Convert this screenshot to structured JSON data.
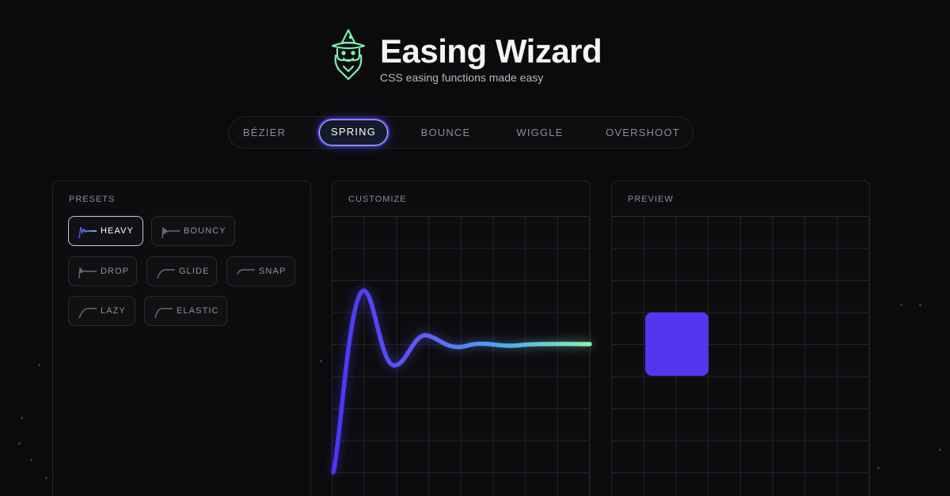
{
  "header": {
    "title": "Easing Wizard",
    "subtitle": "CSS easing functions made easy",
    "logo_icon": "wizard-icon"
  },
  "tabs": [
    {
      "label": "BÉZIER",
      "active": false
    },
    {
      "label": "SPRING",
      "active": true
    },
    {
      "label": "BOUNCE",
      "active": false
    },
    {
      "label": "WIGGLE",
      "active": false
    },
    {
      "label": "OVERSHOOT",
      "active": false
    }
  ],
  "panels": {
    "presets": {
      "label": "PRESETS",
      "items": [
        {
          "label": "HEAVY",
          "active": true
        },
        {
          "label": "BOUNCY",
          "active": false
        },
        {
          "label": "DROP",
          "active": false
        },
        {
          "label": "GLIDE",
          "active": false
        },
        {
          "label": "SNAP",
          "active": false
        },
        {
          "label": "LAZY",
          "active": false
        },
        {
          "label": "ELASTIC",
          "active": false
        }
      ]
    },
    "customize": {
      "label": "CUSTOMIZE"
    },
    "preview": {
      "label": "PREVIEW"
    }
  },
  "colors": {
    "background": "#0b0b0d",
    "accent": "#5536ee",
    "curve_start": "#4b35f5",
    "curve_end": "#8ff0b4",
    "logo": "#7bf0b0"
  }
}
